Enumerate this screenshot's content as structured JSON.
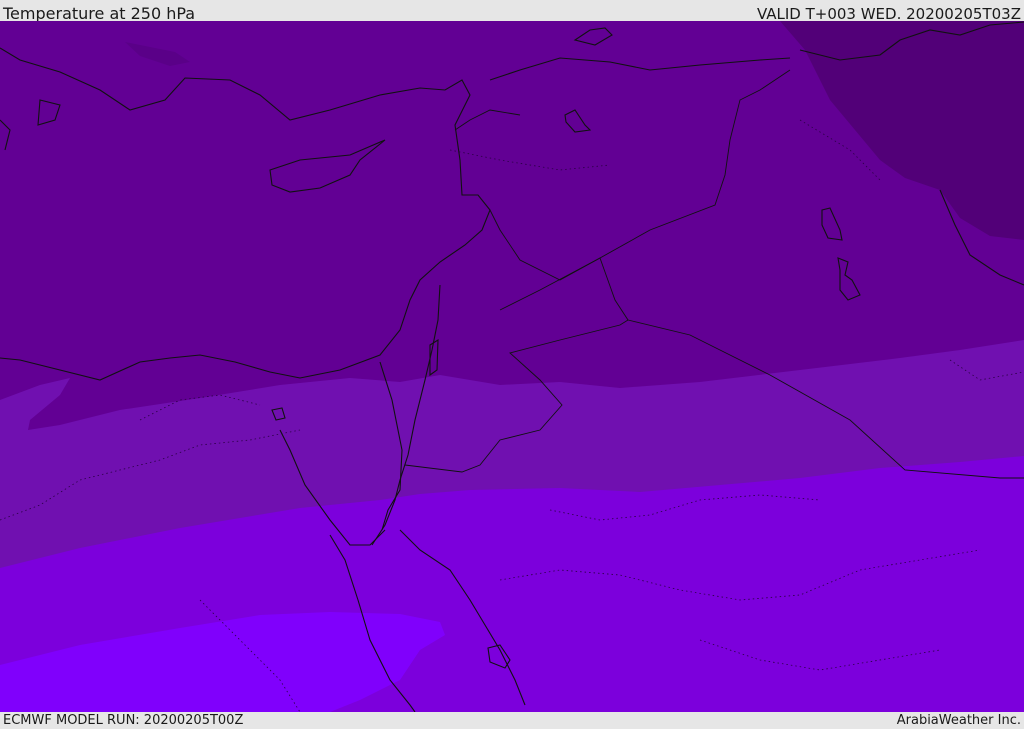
{
  "header": {
    "title": "Temperature at 250 hPa",
    "valid": "VALID T+003 WED. 20200205T03Z"
  },
  "footer": {
    "model_run": "ECMWF MODEL RUN: 20200205T00Z",
    "credit": "ArabiaWeather Inc."
  },
  "colors": {
    "band_darkest": "#520078",
    "band_dark": "#620094",
    "band_mid": "#7010b0",
    "band_bright": "#7c00dc",
    "band_brightest": "#8000fc",
    "coastline": "#111111",
    "background": "#e6e6e6"
  }
}
